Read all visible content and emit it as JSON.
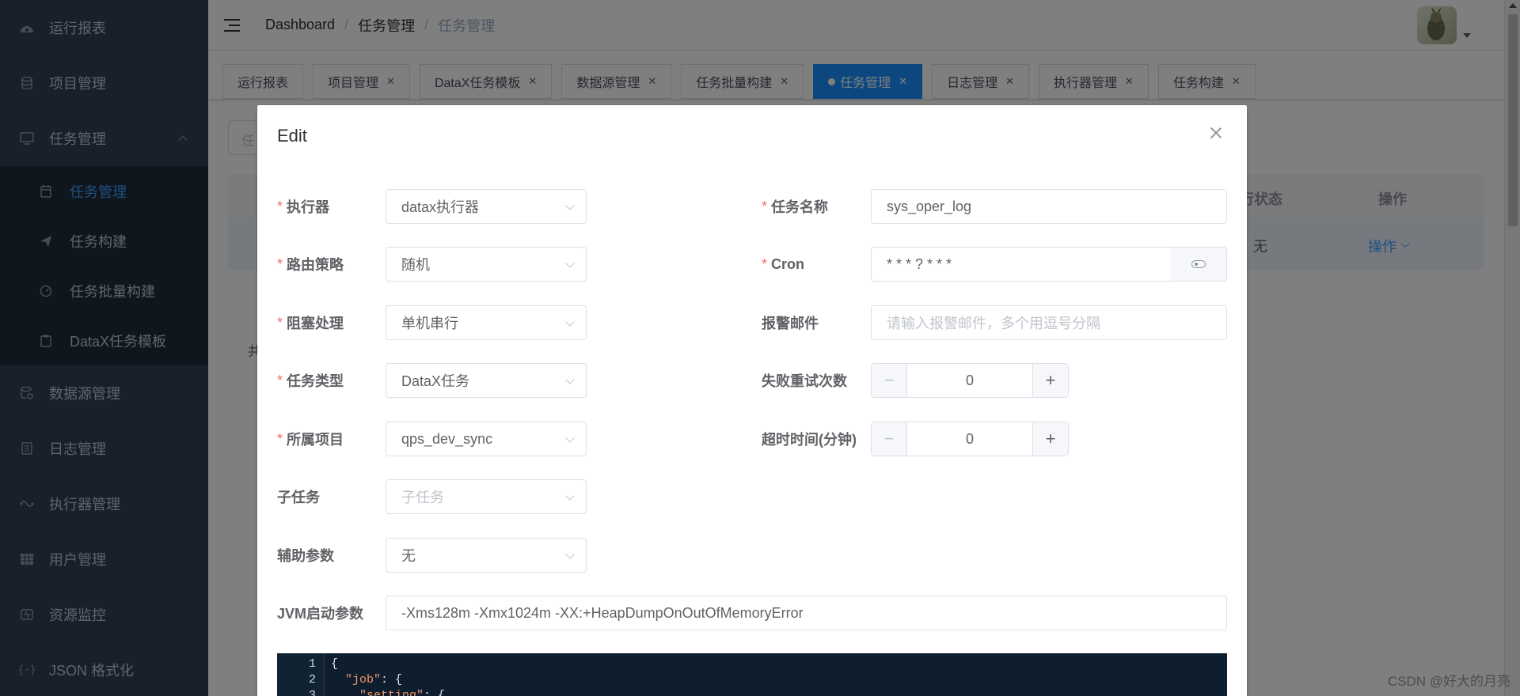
{
  "sidebar": {
    "items": [
      {
        "label": "运行报表",
        "icon": "dashboard-icon"
      },
      {
        "label": "项目管理",
        "icon": "database-icon"
      },
      {
        "label": "任务管理",
        "icon": "monitor-icon",
        "expanded": true
      },
      {
        "label": "数据源管理",
        "icon": "datasource-icon"
      },
      {
        "label": "日志管理",
        "icon": "document-icon"
      },
      {
        "label": "执行器管理",
        "icon": "executor-icon"
      },
      {
        "label": "用户管理",
        "icon": "table-icon"
      },
      {
        "label": "资源监控",
        "icon": "monitor-icon"
      },
      {
        "label": "JSON 格式化",
        "icon": "json-icon"
      }
    ],
    "subitems": [
      {
        "label": "任务管理",
        "icon": "calendar-icon",
        "active": true
      },
      {
        "label": "任务构建",
        "icon": "send-icon"
      },
      {
        "label": "任务批量构建",
        "icon": "speed-icon"
      },
      {
        "label": "DataX任务模板",
        "icon": "clipboard-icon"
      }
    ]
  },
  "breadcrumb": {
    "home": "Dashboard",
    "parent": "任务管理",
    "current": "任务管理"
  },
  "tags": [
    {
      "label": "运行报表",
      "closable": false
    },
    {
      "label": "项目管理",
      "closable": true
    },
    {
      "label": "DataX任务模板",
      "closable": true
    },
    {
      "label": "数据源管理",
      "closable": true
    },
    {
      "label": "任务批量构建",
      "closable": true
    },
    {
      "label": "任务管理",
      "closable": true,
      "active": true
    },
    {
      "label": "日志管理",
      "closable": true
    },
    {
      "label": "执行器管理",
      "closable": true
    },
    {
      "label": "任务构建",
      "closable": true
    }
  ],
  "background": {
    "search_prefix": "任",
    "col_status": "行状态",
    "col_op": "操作",
    "row_status": "无",
    "row_op": "操作",
    "total_prefix": "共"
  },
  "dialog": {
    "title": "Edit",
    "fields": {
      "executor": {
        "label": "执行器",
        "value": "datax执行器"
      },
      "route": {
        "label": "路由策略",
        "value": "随机"
      },
      "block": {
        "label": "阻塞处理",
        "value": "单机串行"
      },
      "task_type": {
        "label": "任务类型",
        "value": "DataX任务"
      },
      "project": {
        "label": "所属项目",
        "value": "qps_dev_sync"
      },
      "subtask": {
        "label": "子任务",
        "placeholder": "子任务"
      },
      "aux": {
        "label": "辅助参数",
        "value": "无"
      },
      "jvm": {
        "label": "JVM启动参数",
        "value": "-Xms128m -Xmx1024m -XX:+HeapDumpOnOutOfMemoryError"
      },
      "task_name": {
        "label": "任务名称",
        "value": "sys_oper_log"
      },
      "cron": {
        "label": "Cron",
        "value": "* * * ? * * *"
      },
      "alarm_email": {
        "label": "报警邮件",
        "placeholder": "请输入报警邮件，多个用逗号分隔"
      },
      "retry": {
        "label": "失败重试次数",
        "value": "0"
      },
      "timeout": {
        "label": "超时时间(分钟)",
        "value": "0"
      }
    },
    "code": {
      "line_numbers": [
        "1",
        "2",
        "3"
      ],
      "line1": "{",
      "line2_key": "\"job\"",
      "line2_rest": ": {",
      "line3_key": "\"setting\"",
      "line3_rest": ": {"
    }
  },
  "watermark": "CSDN @好大的月亮"
}
